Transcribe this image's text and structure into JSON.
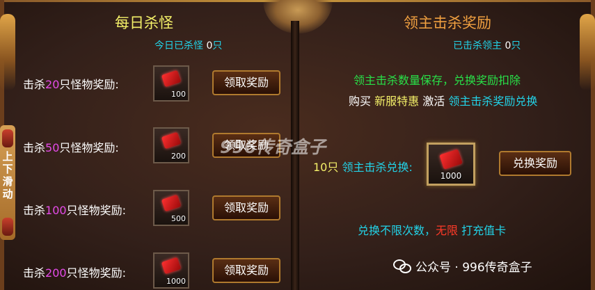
{
  "left_panel": {
    "title": "每日杀怪",
    "kills_prefix": "今日已杀怪",
    "kills_count": "0",
    "kills_suffix": "只",
    "rows": [
      {
        "prefix": "击杀",
        "count": "20",
        "suffix": "只怪物奖励:",
        "qty": "100",
        "button": "领取奖励"
      },
      {
        "prefix": "击杀",
        "count": "50",
        "suffix": "只怪物奖励:",
        "qty": "200",
        "button": "领取奖励"
      },
      {
        "prefix": "击杀",
        "count": "100",
        "suffix": "只怪物奖励:",
        "qty": "500",
        "button": "领取奖励"
      },
      {
        "prefix": "击杀",
        "count": "200",
        "suffix": "只怪物奖励:",
        "qty": "1000",
        "button": "领取奖励"
      }
    ]
  },
  "scroll_tab": {
    "line1": "上",
    "line2": "下",
    "line3": "滑",
    "line4": "动"
  },
  "right_panel": {
    "title": "领主击杀奖励",
    "kills_prefix": "已击杀领主",
    "kills_count": "0",
    "kills_suffix": "只",
    "note1": "领主击杀数量保存，兑换奖励扣除",
    "note2_a": "购买",
    "note2_b": "新服特惠",
    "note2_c": "激活",
    "note2_d": "领主击杀奖励兑换",
    "exchange_count": "10只",
    "exchange_label": "领主击杀兑换:",
    "exchange_qty": "1000",
    "exchange_button": "兑换奖励",
    "note3_a": "兑换不限次数，",
    "note3_b": "无限",
    "note3_c": "打充值卡"
  },
  "watermark": "996传奇盒子",
  "wechat": {
    "label": "公众号 · 996传奇盒子"
  },
  "colors": {
    "title_yellow": "#f4f069",
    "title_orange": "#f0a040",
    "cyan": "#22d3e8",
    "green": "#28e048",
    "magenta": "#e44be8",
    "red": "#ff3a28"
  }
}
